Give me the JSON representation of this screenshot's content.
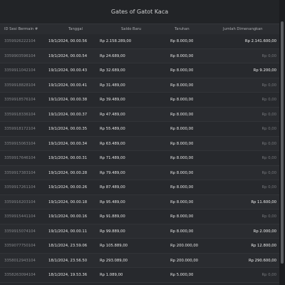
{
  "window": {
    "title": "Gates of Gatot Kaca"
  },
  "table": {
    "columns": {
      "id": "ID Sesi Bermain #",
      "date": "Tanggal",
      "saldo": "Saldo Baru",
      "taruhan": "Taruhan",
      "win": "Jumlah Dimenangkan"
    },
    "rows": [
      {
        "id": "3359926222104",
        "date": "19/1/2024, 00.00.56",
        "saldo": "Rp 2.158.289,00",
        "taruhan": "Rp 8.000,00",
        "win": "Rp 2.141.600,00"
      },
      {
        "id": "3359903596104",
        "date": "19/1/2024, 00.00.54",
        "saldo": "Rp 24.689,00",
        "taruhan": "Rp 8.000,00",
        "win": "Rp 0,00"
      },
      {
        "id": "3359911042104",
        "date": "19/1/2024, 00.00.43",
        "saldo": "Rp 32.689,00",
        "taruhan": "Rp 8.000,00",
        "win": "Rp 9.200,00"
      },
      {
        "id": "3359918828104",
        "date": "19/1/2024, 00.00.41",
        "saldo": "Rp 31.489,00",
        "taruhan": "Rp 8.000,00",
        "win": "Rp 0,00"
      },
      {
        "id": "3359918576104",
        "date": "19/1/2024, 00.00.38",
        "saldo": "Rp 39.489,00",
        "taruhan": "Rp 8.000,00",
        "win": "Rp 0,00"
      },
      {
        "id": "3359918336104",
        "date": "19/1/2024, 00.00.37",
        "saldo": "Rp 47.489,00",
        "taruhan": "Rp 8.000,00",
        "win": "Rp 0,00"
      },
      {
        "id": "3359918172104",
        "date": "19/1/2024, 00.00.35",
        "saldo": "Rp 55.489,00",
        "taruhan": "Rp 8.000,00",
        "win": "Rp 0,00"
      },
      {
        "id": "3359915063104",
        "date": "19/1/2024, 00.00.34",
        "saldo": "Rp 63.489,00",
        "taruhan": "Rp 8.000,00",
        "win": "Rp 0,00"
      },
      {
        "id": "3359917646104",
        "date": "19/1/2024, 00.00.31",
        "saldo": "Rp 71.489,00",
        "taruhan": "Rp 8.000,00",
        "win": "Rp 0,00"
      },
      {
        "id": "3359917383104",
        "date": "19/1/2024, 00.00.28",
        "saldo": "Rp 79.489,00",
        "taruhan": "Rp 8.000,00",
        "win": "Rp 0,00"
      },
      {
        "id": "3359917261104",
        "date": "19/1/2024, 00.00.26",
        "saldo": "Rp 87.489,00",
        "taruhan": "Rp 8.000,00",
        "win": "Rp 0,00"
      },
      {
        "id": "3359916203104",
        "date": "19/1/2024, 00.00.18",
        "saldo": "Rp 95.489,00",
        "taruhan": "Rp 8.000,00",
        "win": "Rp 11.600,00"
      },
      {
        "id": "3359915441104",
        "date": "19/1/2024, 00.00.16",
        "saldo": "Rp 91.889,00",
        "taruhan": "Rp 8.000,00",
        "win": "Rp 0,00"
      },
      {
        "id": "3359915074104",
        "date": "19/1/2024, 00.00.11",
        "saldo": "Rp 99.889,00",
        "taruhan": "Rp 8.000,00",
        "win": "Rp 2.000,00"
      },
      {
        "id": "3359077750104",
        "date": "18/1/2024, 23.59.06",
        "saldo": "Rp 105.889,00",
        "taruhan": "Rp 200.000,00",
        "win": "Rp 12.800,00"
      },
      {
        "id": "3358012943104",
        "date": "18/1/2024, 23.56.50",
        "saldo": "Rp 293.089,00",
        "taruhan": "Rp 200.000,00",
        "win": "Rp 290.600,00"
      },
      {
        "id": "3358263094104",
        "date": "18/1/2024, 19.53.36",
        "saldo": "Rp 1.089,00",
        "taruhan": "Rp 5.000,00",
        "win": "Rp 0,00"
      }
    ]
  }
}
